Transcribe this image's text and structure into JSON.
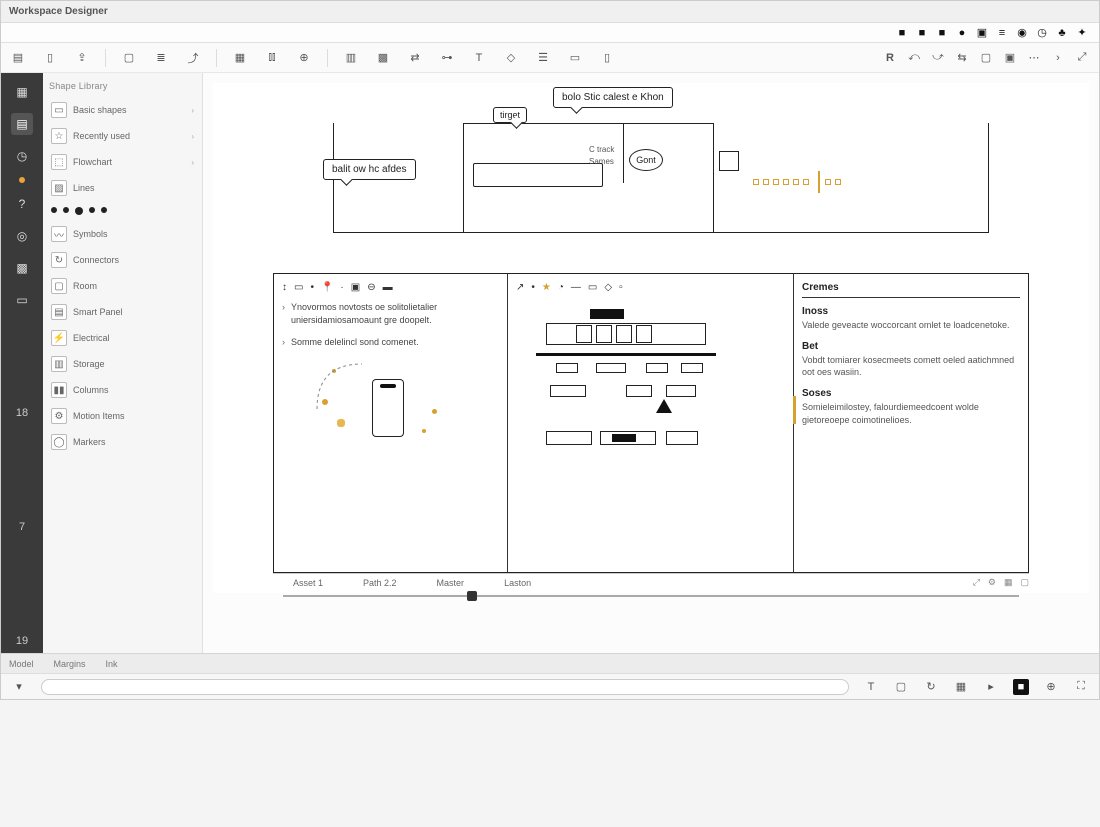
{
  "window": {
    "title": "Workspace Designer"
  },
  "menubar_icons": [
    "square",
    "square",
    "square",
    "circle",
    "triangle",
    "bars",
    "user",
    "clock",
    "cloud",
    "gear"
  ],
  "ribbon": {
    "tools": [
      "layers",
      "group",
      "share",
      "page",
      "align",
      "image",
      "add",
      "chart",
      "chart2",
      "table",
      "spacer",
      "box",
      "move",
      "grid",
      "text",
      "link",
      "shape",
      "menu",
      "box2"
    ],
    "right": [
      "R",
      "arrow",
      "back",
      "swap",
      "sq1",
      "sq2",
      "more",
      "arrow-right",
      "expand"
    ]
  },
  "rail": {
    "items": [
      "home",
      "layers",
      "history",
      "help",
      "target",
      "grid",
      "view"
    ],
    "numbers": [
      "18",
      "7",
      "19"
    ]
  },
  "sidepanel": {
    "header": "Shape Library",
    "items": [
      {
        "label": "Basic shapes"
      },
      {
        "label": "Recently used"
      },
      {
        "label": "Flowchart"
      },
      {
        "label": "Lines"
      },
      {
        "label": "Symbols"
      },
      {
        "label": "Connectors"
      },
      {
        "label": "Room"
      },
      {
        "label": "Smart Panel"
      },
      {
        "label": "Electrical"
      },
      {
        "label": "Storage"
      },
      {
        "label": "Columns"
      },
      {
        "label": "Motion Items"
      },
      {
        "label": "Markers"
      }
    ]
  },
  "diagram": {
    "callout_top": "bolo Stic calest e Khon",
    "callout_left": "balit ow hc afdes",
    "small_label": "tirget",
    "circle_label": "Gont",
    "tiny1": "C track",
    "tiny2": "Sames"
  },
  "panels": {
    "left": {
      "note1": "Ynovormos novtosts oe solitolietalier uniersidamiosamoaunt gre doopelt.",
      "note2": "Somme delelincl sond comenet."
    },
    "right": {
      "title": "Cremes",
      "sec1_h": "Inoss",
      "sec1_p": "Valede geveacte woccorcant omlet te loadcenetoke.",
      "sec2_h": "Bet",
      "sec2_p": "Vobdt tomiarer kosecmeets comett oeled aatichmned oot oes wasiin.",
      "sec3_h": "Soses",
      "sec3_p": "Somieleimilostey, falourdiemeedcoent wolde gietoreoepe coimotinelioes."
    }
  },
  "tabs": [
    "Asset 1",
    "Path 2.2",
    "Master",
    "Laston"
  ],
  "bottombar": [
    "Model",
    "Margins",
    "Ink"
  ]
}
